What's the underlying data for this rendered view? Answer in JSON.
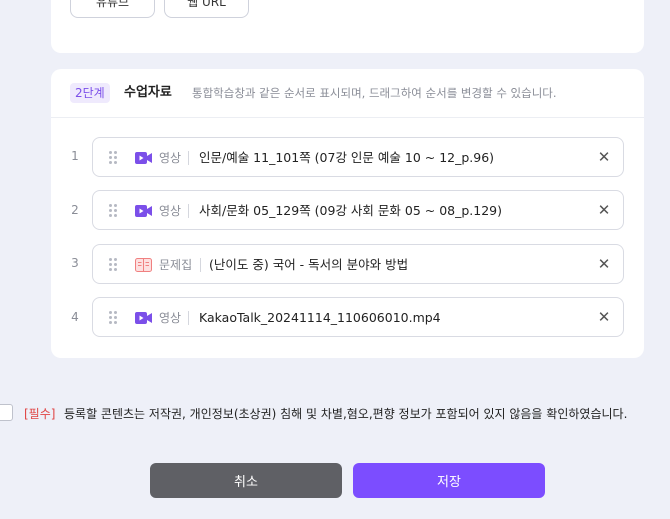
{
  "top_section": {
    "buttons": [
      {
        "label": "유튜브"
      },
      {
        "label": "웹 URL"
      }
    ]
  },
  "materials": {
    "step_badge": "2단계",
    "title": "수업자료",
    "description": "통합학습창과 같은 순서로 표시되며, 드래그하여 순서를 변경할 수 있습니다.",
    "items": [
      {
        "number": "1",
        "type": "video",
        "type_label": "영상",
        "title": "인문/예술 11_101쪽 (07강 인문 예술 10 ~ 12_p.96)"
      },
      {
        "number": "2",
        "type": "video",
        "type_label": "영상",
        "title": "사회/문화 05_129쪽 (09강 사회 문화 05 ~ 08_p.129)"
      },
      {
        "number": "3",
        "type": "quiz",
        "type_label": "문제집",
        "title": "(난이도 중) 국어 - 독서의 분야와 방법"
      },
      {
        "number": "4",
        "type": "video",
        "type_label": "영상",
        "title": "KakaoTalk_20241114_110606010.mp4"
      }
    ]
  },
  "consent": {
    "required_label": "[필수]",
    "text": "등록할 콘텐츠는 저작권, 개인정보(초상권) 침해 및 차별,혐오,편향 정보가 포함되어 있지 않음을 확인하였습니다."
  },
  "actions": {
    "cancel_label": "취소",
    "save_label": "저장"
  },
  "colors": {
    "accent": "#7c4dff",
    "video_icon": "#7b4fe9",
    "quiz_icon": "#f08080",
    "required": "#e04444",
    "cancel_button": "#5f6065"
  }
}
